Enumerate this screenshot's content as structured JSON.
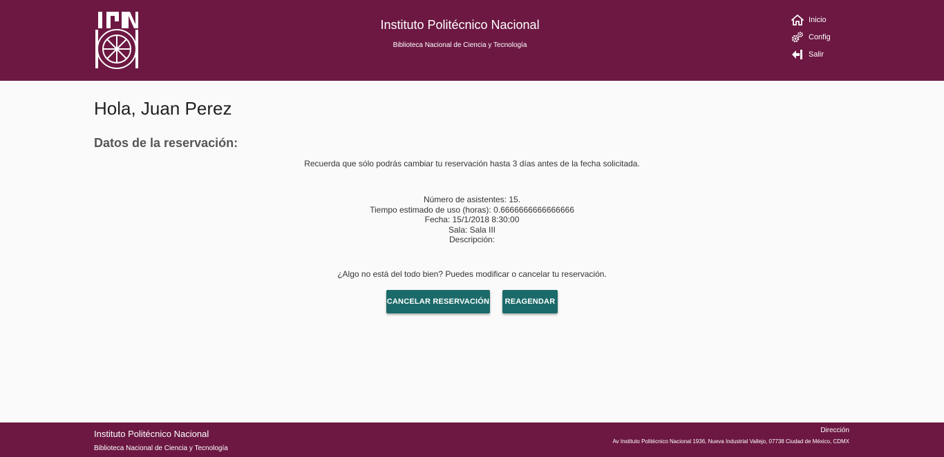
{
  "header": {
    "title": "Instituto Politécnico Nacional",
    "subtitle": "Biblioteca Nacional de Ciencia y Tecnología",
    "logo_text": "IPN",
    "nav": [
      {
        "label": "Inicio",
        "icon": "home-icon"
      },
      {
        "label": "Config",
        "icon": "gears-icon"
      },
      {
        "label": "Salir",
        "icon": "sign-out-icon"
      }
    ]
  },
  "main": {
    "greeting": "Hola, Juan Perez",
    "section_title": "Datos de la reservación:",
    "notice": "Recuerda que sólo podrás cambiar tu reservación hasta 3 días antes de la fecha solicitada.",
    "details": {
      "attendees": "Número de asistentes: 15.",
      "time": "Tiempo estimado de uso (horas): 0.6666666666666666",
      "date": "Fecha: 15/1/2018 8:30:00",
      "room": "Sala: Sala III",
      "description": "Descripción:"
    },
    "question": "¿Algo no está del todo bien? Puedes modificar o cancelar tu reservación.",
    "buttons": {
      "cancel": "CANCELAR RESERVACIÓN",
      "reschedule": "REAGENDAR"
    }
  },
  "footer": {
    "title": "Instituto Politécnico Nacional",
    "subtitle": "Biblioteca Nacional de Ciencia y Tecnología",
    "address_label": "Dirección",
    "address": "Av Instituto Politécnico Nacional 1936, Nueva Industrial Vallejo, 07738 Ciudad de México, CDMX"
  },
  "colors": {
    "brand": "#6c1842",
    "button": "#1b6a6a",
    "background": "#fafafa"
  }
}
